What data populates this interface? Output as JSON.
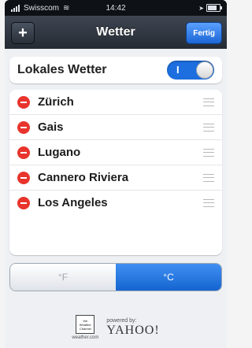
{
  "status_bar": {
    "carrier": "Swisscom",
    "time": "14:42"
  },
  "navbar": {
    "title": "Wetter",
    "add_label": "+",
    "done_label": "Fertig"
  },
  "local_weather": {
    "label": "Lokales Wetter",
    "toggle_state": "I"
  },
  "cities": [
    {
      "name": "Zürich"
    },
    {
      "name": "Gais"
    },
    {
      "name": "Lugano"
    },
    {
      "name": "Cannero Riviera"
    },
    {
      "name": "Los Angeles"
    }
  ],
  "units": {
    "fahrenheit": "°F",
    "celsius": "°C",
    "selected": "celsius"
  },
  "footer": {
    "twc_logo_text": "the Weather Channel",
    "twc_domain": "weather.com",
    "powered_by": "powered by:",
    "yahoo": "YAHOO!"
  },
  "colors": {
    "accent": "#1565d1",
    "delete": "#e8342c",
    "navbar": "#2f3640"
  }
}
